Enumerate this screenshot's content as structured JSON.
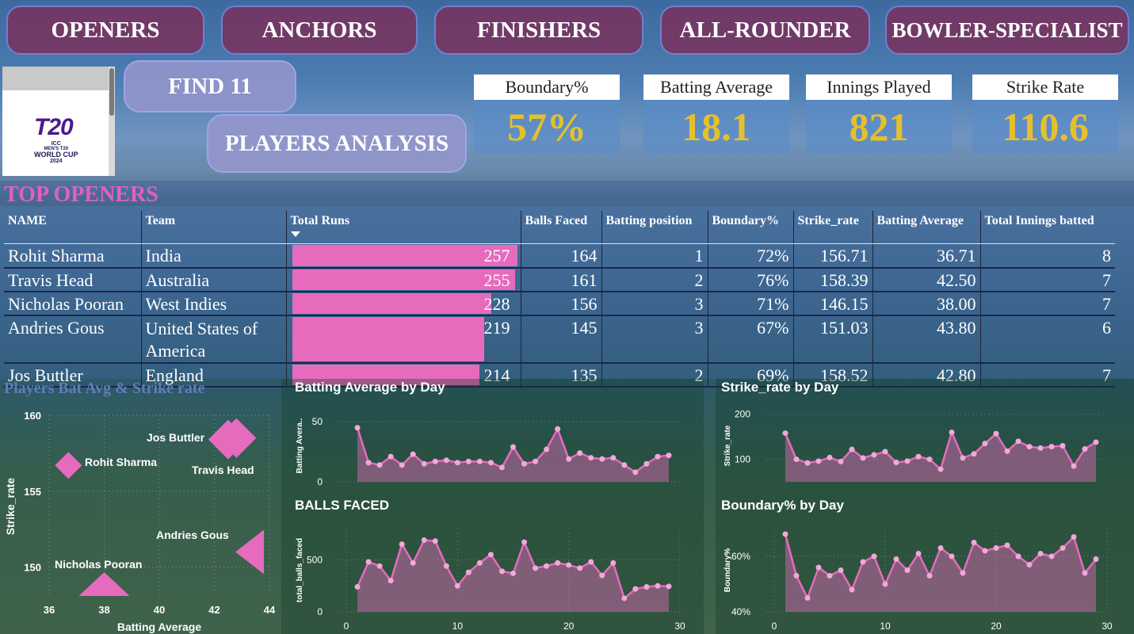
{
  "nav": {
    "openers": "OPENERS",
    "anchors": "ANCHORS",
    "finishers": "FINISHERS",
    "all_rounder": "ALL-ROUNDER",
    "bowler_specialist": "BOWLER-SPECIALIST"
  },
  "side": {
    "find11": "FIND 11",
    "players_analysis": "PLAYERS ANALYSIS"
  },
  "logo": {
    "line1": "ICC",
    "line2": "MEN'S T20",
    "line3": "WORLD CUP",
    "line4": "2024",
    "mark": "T20"
  },
  "kpis": [
    {
      "label": "Boundary%",
      "value": "57%"
    },
    {
      "label": "Batting Average",
      "value": "18.1"
    },
    {
      "label": "Innings Played",
      "value": "821"
    },
    {
      "label": "Strike Rate",
      "value": "110.6"
    }
  ],
  "section_title": "TOP OPENERS",
  "table": {
    "headers": [
      "NAME",
      "Team",
      "Total Runs",
      "Balls Faced",
      "Batting position",
      "Boundary%",
      "Strike_rate",
      "Batting Average",
      "Total Innings batted"
    ],
    "rows": [
      {
        "name": "Rohit Sharma",
        "team": "India",
        "runs": "257",
        "runs_value": 257,
        "balls": "164",
        "pos": "1",
        "boundary": "72%",
        "sr": "156.71",
        "avg": "36.71",
        "inn": "8"
      },
      {
        "name": "Travis Head",
        "team": "Australia",
        "runs": "255",
        "runs_value": 255,
        "balls": "161",
        "pos": "2",
        "boundary": "76%",
        "sr": "158.39",
        "avg": "42.50",
        "inn": "7"
      },
      {
        "name": "Nicholas Pooran",
        "team": "West Indies",
        "runs": "228",
        "runs_value": 228,
        "balls": "156",
        "pos": "3",
        "boundary": "71%",
        "sr": "146.15",
        "avg": "38.00",
        "inn": "7"
      },
      {
        "name": "Andries Gous",
        "team": "United States of America",
        "runs": "219",
        "runs_value": 219,
        "balls": "145",
        "pos": "3",
        "boundary": "67%",
        "sr": "151.03",
        "avg": "43.80",
        "inn": "6"
      },
      {
        "name": "Jos Buttler",
        "team": "England",
        "runs": "214",
        "runs_value": 214,
        "balls": "135",
        "pos": "2",
        "boundary": "69%",
        "sr": "158.52",
        "avg": "42.80",
        "inn": "7"
      }
    ]
  },
  "chart_data": [
    {
      "type": "scatter",
      "title": "Players Bat Avg & Strike rate",
      "xlabel": "Batting Average",
      "ylabel": "Strike_rate",
      "xlim": [
        36,
        44
      ],
      "ylim": [
        148,
        160
      ],
      "xticks": [
        "36",
        "38",
        "40",
        "42",
        "44"
      ],
      "yticks": [
        "150",
        "155",
        "160"
      ],
      "points": [
        {
          "name": "Jos Buttler",
          "x": 42.8,
          "y": 158.5,
          "marker": "diamond-large"
        },
        {
          "name": "Rohit Sharma",
          "x": 36.7,
          "y": 156.7,
          "marker": "diamond"
        },
        {
          "name": "Travis Head",
          "x": 42.5,
          "y": 158.4,
          "marker": "diamond-large"
        },
        {
          "name": "Andries Gous",
          "x": 43.8,
          "y": 151.0,
          "marker": "triangle-left"
        },
        {
          "name": "Nicholas Pooran",
          "x": 38.0,
          "y": 146.2,
          "marker": "triangle-up"
        }
      ],
      "color": "#e66bbd"
    },
    {
      "type": "area",
      "title": "Batting Average by Day",
      "ylabel": "Batting Avera..",
      "ylim": [
        0,
        60
      ],
      "yticks": [
        "0",
        "50"
      ],
      "x": [
        1,
        2,
        3,
        4,
        5,
        6,
        7,
        8,
        9,
        10,
        11,
        12,
        13,
        14,
        15,
        16,
        17,
        18,
        19,
        20,
        21,
        22,
        23,
        24,
        25,
        26,
        27,
        28,
        29
      ],
      "values": [
        45,
        16,
        14,
        21,
        14,
        23,
        15,
        17,
        18,
        16,
        17,
        17,
        16,
        12,
        29,
        15,
        17,
        27,
        44,
        19,
        24,
        20,
        19,
        20,
        14,
        8,
        15,
        21,
        22
      ],
      "color": "#e66bbd"
    },
    {
      "type": "area",
      "title": "Strike_rate by Day",
      "ylabel": "Strike_rate",
      "ylim": [
        50,
        210
      ],
      "yticks": [
        "100",
        "200"
      ],
      "x": [
        1,
        2,
        3,
        4,
        5,
        6,
        7,
        8,
        9,
        10,
        11,
        12,
        13,
        14,
        15,
        16,
        17,
        18,
        19,
        20,
        21,
        22,
        23,
        24,
        25,
        26,
        27,
        28,
        29
      ],
      "values": [
        158,
        100,
        92,
        96,
        104,
        95,
        122,
        103,
        110,
        117,
        93,
        96,
        106,
        100,
        78,
        160,
        103,
        112,
        135,
        157,
        118,
        140,
        128,
        125,
        128,
        130,
        85,
        123,
        138
      ],
      "color": "#e66bbd"
    },
    {
      "type": "area",
      "title": "BALLS FACED",
      "xlabel": "",
      "ylabel": "total_balls_faced",
      "ylim": [
        0,
        800
      ],
      "xticks": [
        "0",
        "10",
        "20",
        "30"
      ],
      "yticks": [
        "0",
        "500"
      ],
      "x": [
        1,
        2,
        3,
        4,
        5,
        6,
        7,
        8,
        9,
        10,
        11,
        12,
        13,
        14,
        15,
        16,
        17,
        18,
        19,
        20,
        21,
        22,
        23,
        24,
        25,
        26,
        27,
        28,
        29
      ],
      "values": [
        240,
        480,
        440,
        300,
        650,
        470,
        690,
        680,
        440,
        250,
        380,
        470,
        550,
        390,
        370,
        670,
        420,
        440,
        470,
        450,
        420,
        480,
        350,
        470,
        130,
        220,
        240,
        250,
        245
      ],
      "color": "#e66bbd"
    },
    {
      "type": "area",
      "title": "Boundary% by Day",
      "ylabel": "Boundary%",
      "ylim": [
        40,
        70
      ],
      "xticks": [
        "0",
        "10",
        "20",
        "30"
      ],
      "yticks": [
        "40%",
        "60%"
      ],
      "x": [
        1,
        2,
        3,
        4,
        5,
        6,
        7,
        8,
        9,
        10,
        11,
        12,
        13,
        14,
        15,
        16,
        17,
        18,
        19,
        20,
        21,
        22,
        23,
        24,
        25,
        26,
        27,
        28,
        29
      ],
      "values": [
        68,
        53,
        45,
        56,
        53,
        55,
        48,
        58,
        60,
        50,
        59,
        55,
        61,
        53,
        63,
        60,
        54,
        65,
        62,
        63,
        64,
        60,
        57,
        61,
        60,
        63,
        67,
        54,
        59
      ],
      "color": "#e66bbd"
    }
  ]
}
